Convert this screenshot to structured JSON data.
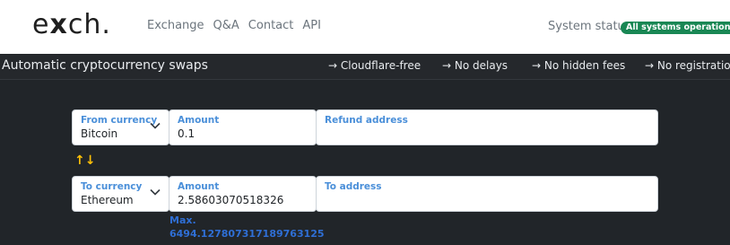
{
  "header": {
    "logo_left": "e",
    "logo_x": "x",
    "logo_right": "ch.",
    "nav": [
      "Exchange",
      "Q&A",
      "Contact",
      "API"
    ],
    "status_label": "System status",
    "status_badge": "All systems operational",
    "badge_color": "#198754"
  },
  "banner": {
    "title": "Automatic cryptocurrency swaps",
    "features": [
      "→ Cloudflare-free",
      "→ No delays",
      "→ No hidden fees",
      "→ No registration"
    ]
  },
  "from": {
    "currency_label": "From currency",
    "currency_value": "Bitcoin",
    "amount_label": "Amount",
    "amount_value": "0.1",
    "address_label": "Refund address"
  },
  "swap_icon": "↑↓",
  "to": {
    "currency_label": "To currency",
    "currency_value": "Ethereum",
    "amount_label": "Amount",
    "amount_value": "2.58603070518326",
    "address_label": "To address"
  },
  "max": {
    "label": "Max.",
    "value": "6494.127807317189763125"
  }
}
